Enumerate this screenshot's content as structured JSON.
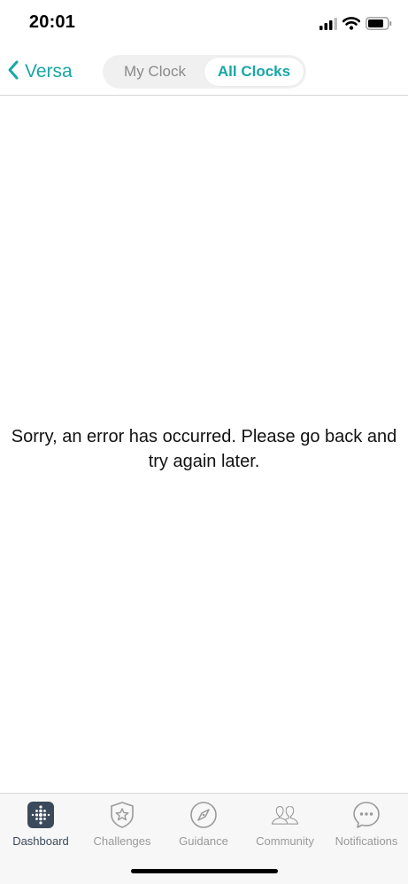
{
  "status_bar": {
    "time": "20:01",
    "icons": [
      "cellular-signal-icon",
      "wifi-icon",
      "battery-icon"
    ]
  },
  "nav": {
    "back_label": "Versa",
    "segments": [
      {
        "label": "My Clock",
        "selected": false
      },
      {
        "label": "All Clocks",
        "selected": true
      }
    ]
  },
  "main": {
    "error_message": "Sorry, an error has occurred. Please go back and try again later."
  },
  "tab_bar": {
    "tabs": [
      {
        "label": "Dashboard",
        "icon": "fitbit-dots-icon",
        "selected": true
      },
      {
        "label": "Challenges",
        "icon": "star-shield-icon",
        "selected": false
      },
      {
        "label": "Guidance",
        "icon": "compass-icon",
        "selected": false
      },
      {
        "label": "Community",
        "icon": "people-icon",
        "selected": false
      },
      {
        "label": "Notifications",
        "icon": "chat-bubble-icon",
        "selected": false
      }
    ]
  },
  "colors": {
    "accent": "#19a6a6",
    "inactive": "#9a9a9a",
    "active_tab": "#3b4a5a"
  }
}
